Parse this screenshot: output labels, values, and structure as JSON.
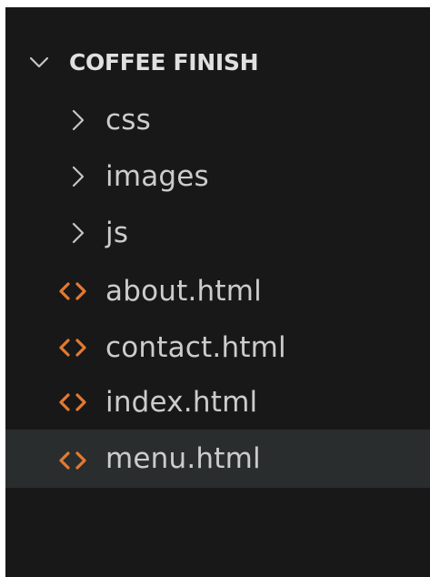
{
  "explorer": {
    "root": {
      "label": "COFFEE FINISH",
      "expanded": true,
      "chevron_icon": "chevron-down-icon"
    },
    "folders": [
      {
        "label": "css",
        "expanded": false,
        "icon": "chevron-right-icon"
      },
      {
        "label": "images",
        "expanded": false,
        "icon": "chevron-right-icon"
      },
      {
        "label": "js",
        "expanded": false,
        "icon": "chevron-right-icon"
      }
    ],
    "files": [
      {
        "label": "about.html",
        "icon": "html-file-icon",
        "selected": false
      },
      {
        "label": "contact.html",
        "icon": "html-file-icon",
        "selected": false
      },
      {
        "label": "index.html",
        "icon": "html-file-icon",
        "selected": false
      },
      {
        "label": "menu.html",
        "icon": "html-file-icon",
        "selected": true
      }
    ]
  },
  "colors": {
    "background": "#181818",
    "selected_row": "#2a2d2e",
    "text": "#cccccc",
    "root_text": "#e0e0e0",
    "chevron": "#c5c5c5",
    "html_icon": "#e37933"
  }
}
